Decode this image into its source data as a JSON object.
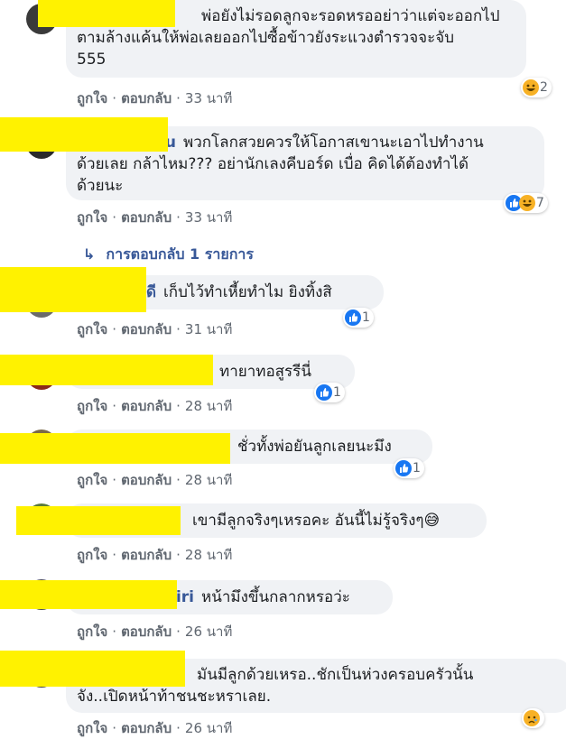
{
  "actions": {
    "like": "ถูกใจ",
    "reply": "ตอบกลับ",
    "separator": "·"
  },
  "replies_link": "การตอบกลับ 1 รายการ",
  "comments": [
    {
      "name": "",
      "lines": [
        "พ่อยังไม่รอดลูกจะรอดหรออย่าว่าแต่จะออกไป",
        "ตามล้างแค้นให้พ่อเลยออกไปซื้อข้าวยังระแวงตำรวจจะจับ",
        "555"
      ],
      "time": "33 นาที",
      "reactions": [
        "haha"
      ],
      "reaction_count": "2"
    },
    {
      "name": "u",
      "lines": [
        "พวกโลกสวยควรให้โอกาสเขานะเอาไปทำงาน",
        "ด้วยเลย กล้าไหม??? อย่านักเลงคีบอร์ด เบื่อ คิดได้ต้องทำได้",
        "ด้วยนะ"
      ],
      "time": "33 นาที",
      "reactions": [
        "like",
        "haha"
      ],
      "reaction_count": "7"
    },
    {
      "name": "ดี",
      "lines": [
        "เก็บไว้ทำเหี้ยทำไม ยิงทิ้งสิ"
      ],
      "time": "31 นาที",
      "reactions": [
        "like"
      ],
      "reaction_count": "1"
    },
    {
      "name": "",
      "lines": [
        "ทายาทอสูรรีนี่"
      ],
      "time": "28 นาที",
      "reactions": [
        "like"
      ],
      "reaction_count": "1"
    },
    {
      "name": "",
      "lines": [
        "ชั่วทั้งพ่อยันลูกเลยนะมึง"
      ],
      "time": "28 นาที",
      "reactions": [
        "like"
      ],
      "reaction_count": "1"
    },
    {
      "name": "",
      "lines": [
        "เขามีลูกจริงๆเหรอคะ อันนี้ไม่รู้จริงๆ😅"
      ],
      "time": "28 นาที",
      "reactions": [],
      "reaction_count": ""
    },
    {
      "name": "iri",
      "lines": [
        "หน้ามึงขึ้นกลากหรอว่ะ"
      ],
      "time": "26 นาที",
      "reactions": [],
      "reaction_count": ""
    },
    {
      "name": "",
      "lines": [
        "มันมีลูกด้วยเหรอ..ชักเป็นห่วงครอบครัวนั้น",
        "จัง..เปิดหน้าท้าชนชะหราเลย."
      ],
      "time": "26 นาที",
      "reactions": [
        "sad"
      ],
      "reaction_count": ""
    }
  ]
}
